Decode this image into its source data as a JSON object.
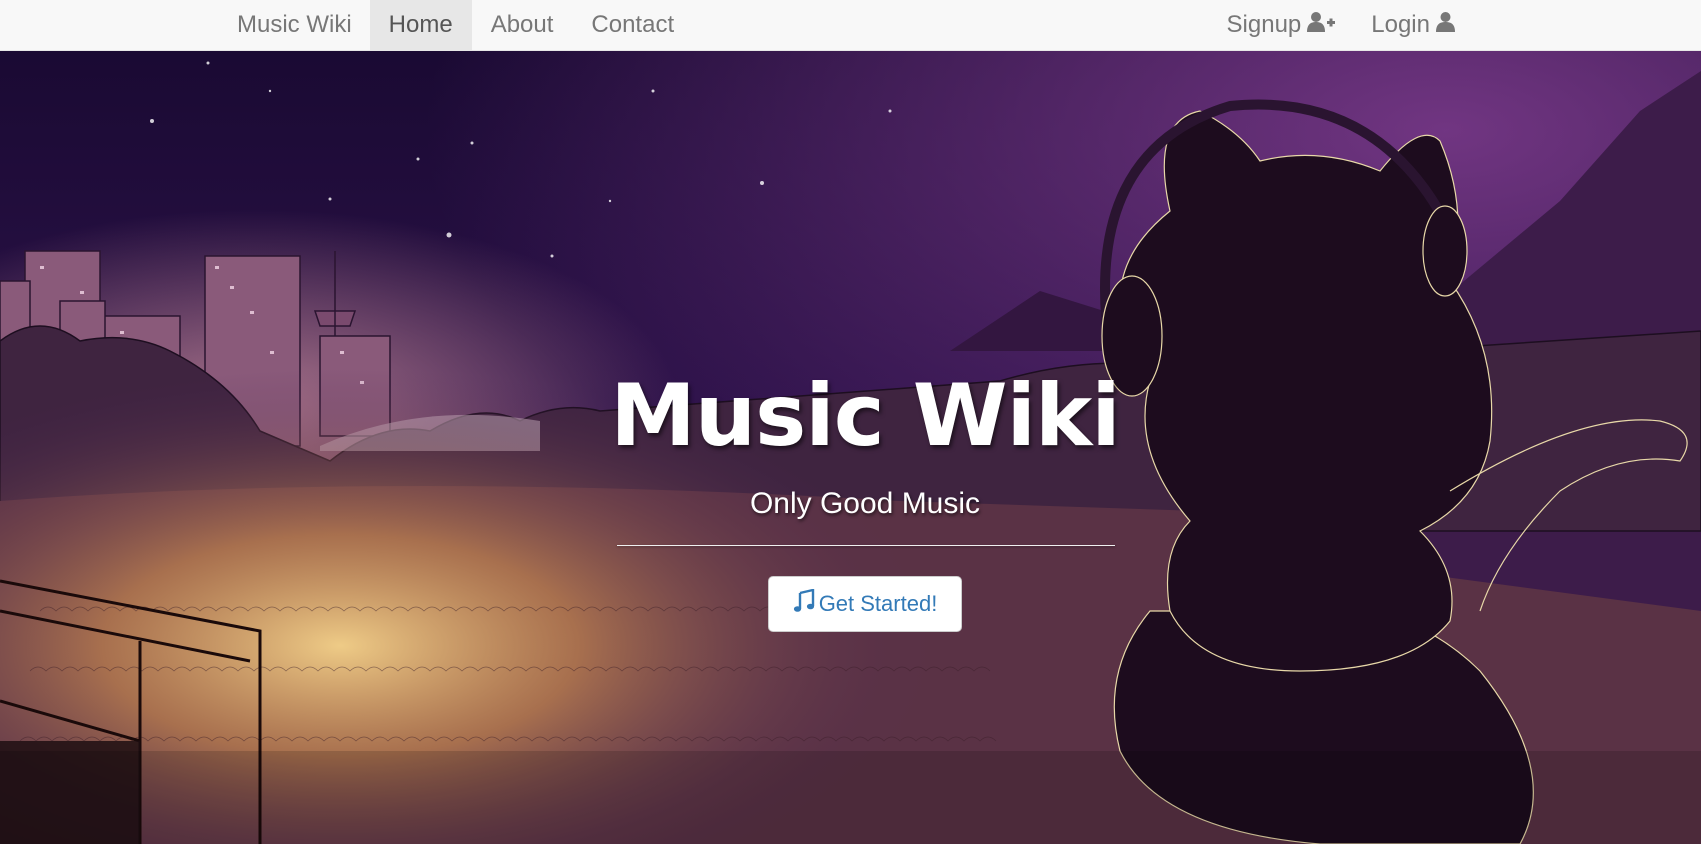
{
  "navbar": {
    "brand": "Music Wiki",
    "links": [
      {
        "label": "Home",
        "active": true
      },
      {
        "label": "About",
        "active": false
      },
      {
        "label": "Contact",
        "active": false
      }
    ],
    "right_links": [
      {
        "label": "Signup",
        "icon": "user-plus-icon"
      },
      {
        "label": "Login",
        "icon": "user-icon"
      }
    ]
  },
  "hero": {
    "title": "Music Wiki",
    "subtitle": "Only Good Music",
    "cta_label": "Get Started!",
    "cta_icon": "music-note-icon"
  },
  "colors": {
    "navbar_bg": "#f8f8f8",
    "active_tab_bg": "#e7e7e7",
    "nav_text": "#777777",
    "cta_text": "#337ab7",
    "sky_top": "#1a0a33",
    "sky_purple": "#5a2a78"
  }
}
